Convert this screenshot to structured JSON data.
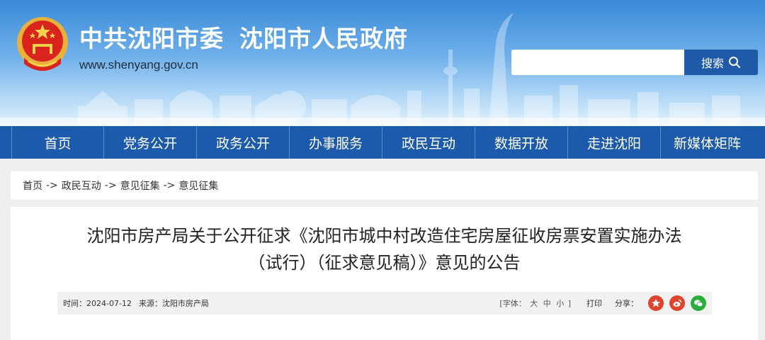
{
  "header": {
    "title_party": "中共沈阳市委",
    "title_gov": "沈阳市人民政府",
    "url": "www.shenyang.gov.cn",
    "emblem_icon": "national-emblem-icon"
  },
  "search": {
    "placeholder": "",
    "button_label": "搜索",
    "icon": "search-icon"
  },
  "nav": {
    "items": [
      {
        "label": "首页"
      },
      {
        "label": "党务公开"
      },
      {
        "label": "政务公开"
      },
      {
        "label": "办事服务"
      },
      {
        "label": "政民互动"
      },
      {
        "label": "数据开放"
      },
      {
        "label": "走进沈阳"
      },
      {
        "label": "新媒体矩阵"
      }
    ]
  },
  "breadcrumb": {
    "items": [
      "首页",
      "政民互动",
      "意见征集",
      "意见征集"
    ],
    "separator": "->"
  },
  "article": {
    "title_line1": "沈阳市房产局关于公开征求《沈阳市城中村改造住宅房屋征收房票安置实施办法",
    "title_line2": "（试行）（征求意见稿）》意见的公告",
    "time_label": "时间：2024-07-12",
    "source_label": "来源：沈阳市房产局",
    "font_size_label": "[字体：",
    "font_large": "大",
    "font_medium": "中",
    "font_small": "小",
    "font_close": "]",
    "print_label": "打印",
    "share_label": "分享："
  },
  "colors": {
    "nav_bg": "#1c5bab",
    "search_btn": "#1e5aa8",
    "share_qzone": "#e0432c",
    "share_weibo": "#e0432c",
    "share_wechat": "#2aae3b"
  },
  "share_icons": [
    "qzone-star-icon",
    "weibo-icon",
    "wechat-icon"
  ]
}
